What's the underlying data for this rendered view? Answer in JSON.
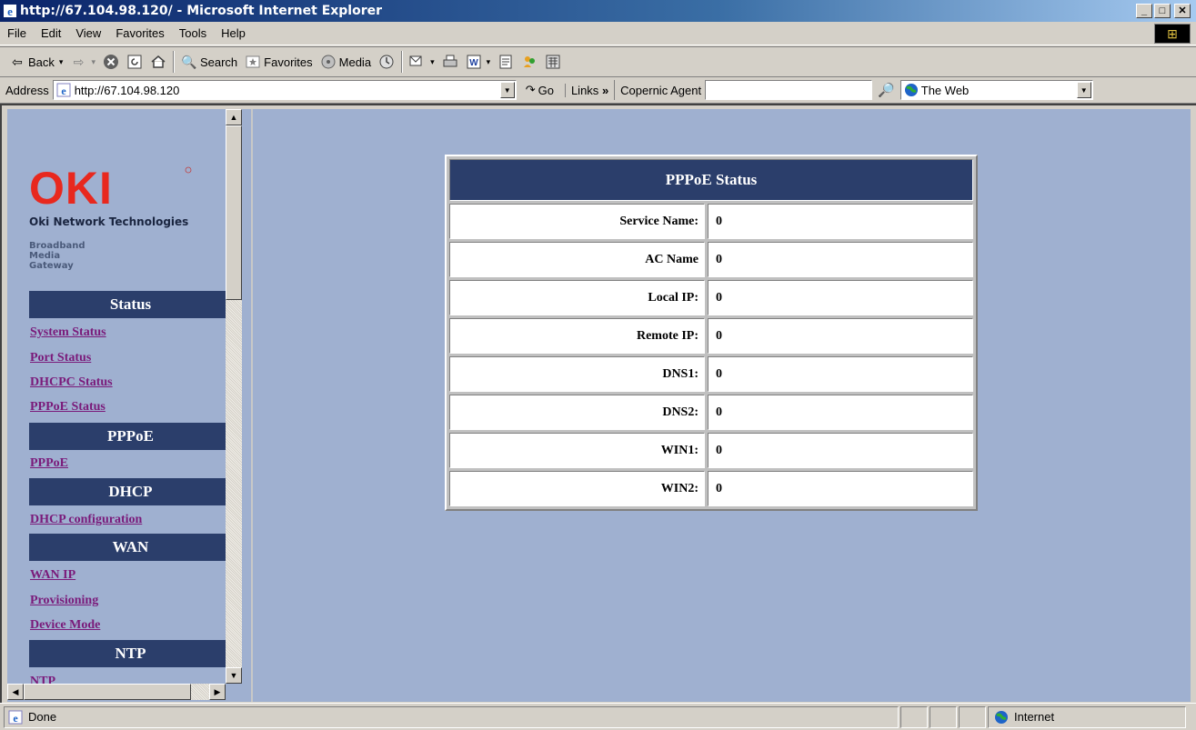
{
  "window": {
    "title": "http://67.104.98.120/ - Microsoft Internet Explorer",
    "minimize": "_",
    "maximize": "□",
    "close": "✕"
  },
  "menu": [
    "File",
    "Edit",
    "View",
    "Favorites",
    "Tools",
    "Help"
  ],
  "toolbar": {
    "back": "Back",
    "search": "Search",
    "favorites": "Favorites",
    "media": "Media"
  },
  "address": {
    "label": "Address",
    "url": "http://67.104.98.120",
    "go": "Go",
    "links": "Links",
    "links_chevron": "»",
    "copernic_label": "Copernic Agent",
    "copernic_value": "",
    "search_scope": "The Web"
  },
  "sidebar": {
    "logo_text": "OKI",
    "company": "Oki Network Technologies",
    "product_lines": [
      "Broadband",
      "Media",
      "Gateway"
    ],
    "sections": [
      {
        "heading": "Status",
        "links": [
          "System Status",
          "Port Status",
          "DHCPC Status",
          "PPPoE Status"
        ]
      },
      {
        "heading": "PPPoE",
        "links": [
          "PPPoE"
        ]
      },
      {
        "heading": "DHCP",
        "links": [
          "DHCP configuration"
        ]
      },
      {
        "heading": "WAN",
        "links": [
          "WAN IP",
          "Provisioning",
          "Device Mode"
        ]
      },
      {
        "heading": "NTP",
        "links": [
          "NTP"
        ]
      }
    ]
  },
  "main": {
    "table_title": "PPPoE Status",
    "rows": [
      {
        "label": "Service Name:",
        "value": "0"
      },
      {
        "label": "AC Name",
        "value": "0"
      },
      {
        "label": "Local IP:",
        "value": "0"
      },
      {
        "label": "Remote IP:",
        "value": "0"
      },
      {
        "label": "DNS1:",
        "value": "0"
      },
      {
        "label": "DNS2:",
        "value": "0"
      },
      {
        "label": "WIN1:",
        "value": "0"
      },
      {
        "label": "WIN2:",
        "value": "0"
      }
    ]
  },
  "statusbar": {
    "status": "Done",
    "zone": "Internet"
  },
  "colors": {
    "page_bg": "#9fb0d0",
    "header_bg": "#2b3e6b",
    "link": "#7a1a7a",
    "oki_red": "#e8281e"
  }
}
